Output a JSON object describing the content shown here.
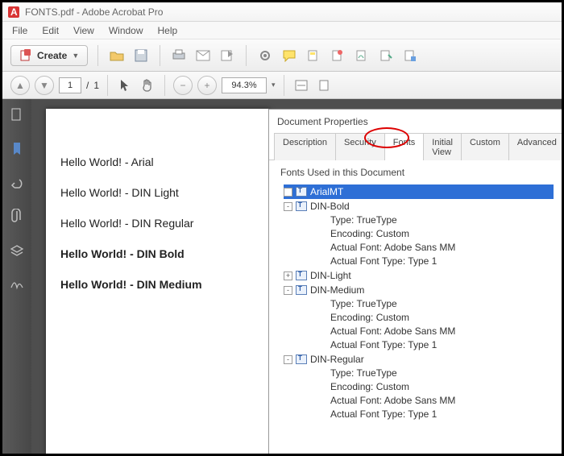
{
  "titlebar": {
    "text": "FONTS.pdf - Adobe Acrobat Pro"
  },
  "menu": {
    "file": "File",
    "edit": "Edit",
    "view": "View",
    "window": "Window",
    "help": "Help"
  },
  "toolbar": {
    "create": "Create"
  },
  "nav": {
    "page_current": "1",
    "page_sep": "/",
    "page_total": "1",
    "zoom": "94.3%",
    "zoom_chev": "▾"
  },
  "document": {
    "lines": {
      "arial": "Hello World! - Arial",
      "din_light": "Hello World! - DIN Light",
      "din_regular": "Hello World! - DIN Regular",
      "din_bold": "Hello World! - DIN Bold",
      "din_medium": "Hello World! - DIN Medium"
    }
  },
  "panel": {
    "title": "Document Properties",
    "tabs": {
      "description": "Description",
      "security": "Security",
      "fonts": "Fonts",
      "initial_view": "Initial View",
      "custom": "Custom",
      "advanced": "Advanced"
    },
    "section_label": "Fonts Used in this Document",
    "fonts": [
      {
        "name": "ArialMT",
        "expander": "+",
        "selected": true
      },
      {
        "name": "DIN-Bold",
        "expander": "-",
        "details": {
          "type": "Type: TrueType",
          "encoding": "Encoding: Custom",
          "actual_font": "Actual Font: Adobe Sans MM",
          "actual_type": "Actual Font Type: Type 1"
        }
      },
      {
        "name": "DIN-Light",
        "expander": "+"
      },
      {
        "name": "DIN-Medium",
        "expander": "-",
        "details": {
          "type": "Type: TrueType",
          "encoding": "Encoding: Custom",
          "actual_font": "Actual Font: Adobe Sans MM",
          "actual_type": "Actual Font Type: Type 1"
        }
      },
      {
        "name": "DIN-Regular",
        "expander": "-",
        "details": {
          "type": "Type: TrueType",
          "encoding": "Encoding: Custom",
          "actual_font": "Actual Font: Adobe Sans MM",
          "actual_type": "Actual Font Type: Type 1"
        }
      }
    ]
  }
}
